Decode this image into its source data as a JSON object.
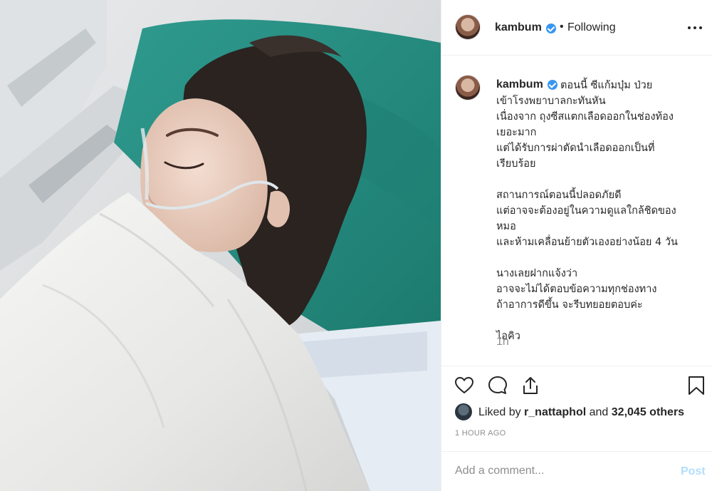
{
  "post": {
    "username": "kambum",
    "follow_state": "Following",
    "separator": "•",
    "caption_first_line": "ตอนนี้ ซีแก้มบุ๋ม ป่วย",
    "caption_rest": "เข้าโรงพยาบาลกะทันหัน\nเนื่องจาก ถุงซีสแตกเลือดออกในช่องท้อง\nเยอะมาก\nแต่ได้รับการผ่าตัดนำเลือดออกเป็นที่\nเรียบร้อย\n\nสถานการณ์ตอนนี้ปลอดภัยดี\nแต่อาจจะต้องอยู่ในความดูแลใกล้ชิดของ\nหมอ\nและห้ามเคลื่อนย้ายตัวเองอย่างน้อย 4 วัน\n\nนางเลยฝากแจ้งว่า\nอาจจะไม่ได้ตอบข้อความทุกช่องทาง\nถ้าอาการดีขึ้น จะรีบทยอยตอบค่ะ\n\nไอคิว",
    "caption_time": "1h",
    "liked_by_prefix": "Liked by",
    "liked_by_user": "r_nattaphol",
    "liked_by_and": "and",
    "liked_by_count": "32,045 others",
    "time_ago": "1 HOUR AGO",
    "comment_placeholder": "Add a comment...",
    "post_label": "Post"
  },
  "colors": {
    "verified": "#3897f0",
    "post_button": "#b2dffc",
    "muted_text": "#8e8e8e"
  },
  "icons": [
    "verified-badge-icon",
    "more-options-icon",
    "heart-icon",
    "comment-icon",
    "share-icon",
    "bookmark-icon"
  ]
}
